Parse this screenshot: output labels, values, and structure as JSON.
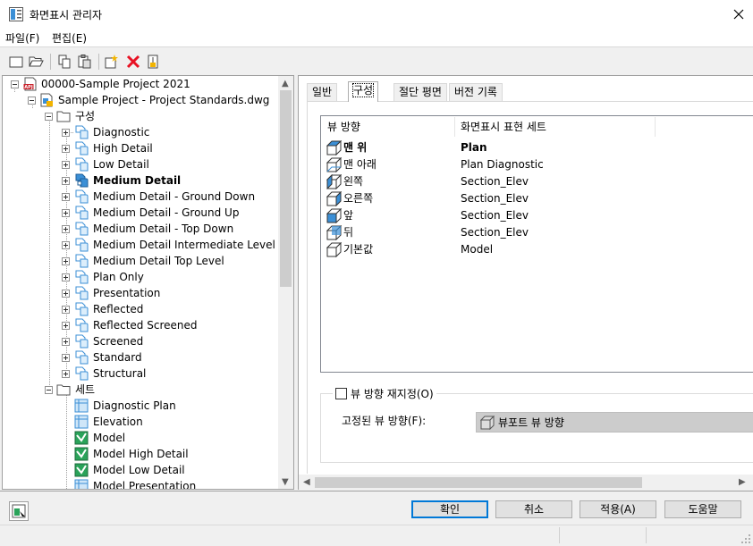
{
  "window": {
    "title": "화면표시 관리자"
  },
  "menu": [
    {
      "label": "파일(F)"
    },
    {
      "label": "편집(E)"
    }
  ],
  "toolbar": {
    "icons": [
      "new-document-icon",
      "open-folder-icon",
      "copy-icon",
      "paste-icon",
      "new-item-icon",
      "delete-icon",
      "purge-icon"
    ],
    "delete_color": "#e81123"
  },
  "tree": {
    "root": "00000-Sample Project 2021",
    "drawing": "Sample Project - Project Standards.dwg",
    "config_folder": "구성",
    "configs": [
      "Diagnostic",
      "High Detail",
      "Low Detail",
      "Medium Detail",
      "Medium Detail - Ground Down",
      "Medium Detail - Ground Up",
      "Medium Detail - Top Down",
      "Medium Detail Intermediate Level",
      "Medium Detail Top Level",
      "Plan Only",
      "Presentation",
      "Reflected",
      "Reflected Screened",
      "Screened",
      "Standard",
      "Structural"
    ],
    "selected_config": "Medium Detail",
    "sets_folder": "세트",
    "sets": [
      "Diagnostic Plan",
      "Elevation",
      "Model",
      "Model High Detail",
      "Model Low Detail",
      "Model Presentation"
    ]
  },
  "tabs": [
    {
      "label": "일반"
    },
    {
      "label": "구성"
    },
    {
      "label": "절단 평면"
    },
    {
      "label": "버전 기록"
    }
  ],
  "active_tab": "구성",
  "list": {
    "col_view": "뷰 방향",
    "col_set": "화면표시 표현 세트",
    "rows": [
      {
        "view": "맨 위",
        "set": "Plan",
        "icon": "top-view-icon"
      },
      {
        "view": "맨 아래",
        "set": "Plan Diagnostic",
        "icon": "bottom-view-icon"
      },
      {
        "view": "왼쪽",
        "set": "Section_Elev",
        "icon": "left-view-icon"
      },
      {
        "view": "오른쪽",
        "set": "Section_Elev",
        "icon": "right-view-icon"
      },
      {
        "view": "앞",
        "set": "Section_Elev",
        "icon": "front-view-icon"
      },
      {
        "view": "뒤",
        "set": "Section_Elev",
        "icon": "back-view-icon"
      },
      {
        "view": "기본값",
        "set": "Model",
        "icon": "default-view-icon"
      }
    ]
  },
  "override": {
    "checkbox_label": "뷰 방향 재지정(O)",
    "checked": false,
    "fixed_label": "고정된 뷰 방향(F):",
    "fixed_value": "뷰포트 뷰 방향"
  },
  "buttons": {
    "ok": "확인",
    "cancel": "취소",
    "apply": "적용(A)",
    "help": "도움말"
  },
  "colors": {
    "accent": "#0078d7",
    "icon_blue": "#3b8fd6",
    "pdf_red": "#c8202a"
  }
}
